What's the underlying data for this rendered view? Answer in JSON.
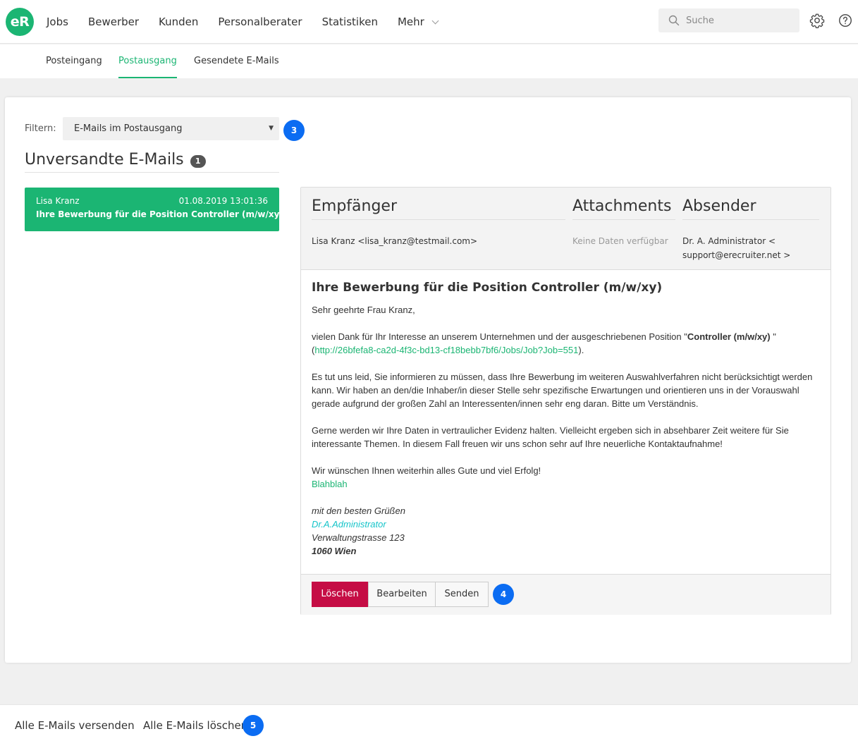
{
  "logo": {
    "text": "eR"
  },
  "nav": {
    "items": [
      "Jobs",
      "Bewerber",
      "Kunden",
      "Personalberater",
      "Statistiken"
    ],
    "more_label": "Mehr"
  },
  "search": {
    "placeholder": "Suche"
  },
  "icons": {
    "settings": "gear-icon",
    "help": "help-circle-icon",
    "search": "search-icon"
  },
  "subnav": {
    "tabs": [
      "Posteingang",
      "Postausgang",
      "Gesendete E-Mails"
    ],
    "active": "Postausgang"
  },
  "filter": {
    "label": "Filtern:",
    "selected": "E-Mails im Postausgang"
  },
  "callouts": {
    "filter": "3",
    "actions": "4",
    "bottom": "5"
  },
  "section": {
    "title": "Unversandte E-Mails",
    "count": "1"
  },
  "mail_list": [
    {
      "name": "Lisa Kranz",
      "date": "01.08.2019 13:01:36",
      "subject": "Ihre Bewerbung für die Position Controller (m/w/xy)"
    }
  ],
  "detail": {
    "recipient_title": "Empfänger",
    "attachments_title": "Attachments",
    "sender_title": "Absender",
    "recipient": "Lisa Kranz <lisa_kranz@testmail.com>",
    "attachments": "Keine Daten verfügbar",
    "sender_line1": "Dr. A. Administrator <",
    "sender_line2": "support@erecruiter.net >",
    "subject": "Ihre Bewerbung für die Position Controller (m/w/xy)",
    "greeting": "Sehr geehrte Frau Kranz,",
    "p1_before": "vielen Dank für Ihr Interesse an unserem Unternehmen und der ausgeschriebenen Position \"",
    "p1_bold": "Controller (m/w/xy)",
    "p1_after": " \"",
    "p1_link_open": "(",
    "p1_link": "http://26bfefa8-ca2d-4f3c-bd13-cf18bebb7bf6/Jobs/Job?Job=551",
    "p1_link_close": ").",
    "p2": "Es tut uns leid, Sie informieren zu müssen, dass Ihre Bewerbung im weiteren Auswahlverfahren nicht berücksichtigt werden kann. Wir haben an den/die Inhaber/in dieser Stelle sehr spezifische Erwartungen und orientieren uns in der Vorauswahl gerade aufgrund der großen Zahl an Interessenten/innen sehr eng daran. Bitte um Verständnis.",
    "p3": "Gerne werden wir Ihre Daten in vertraulicher Evidenz halten. Vielleicht ergeben sich in absehbarer Zeit weitere für Sie interessante Themen. In diesem Fall freuen wir uns schon sehr auf Ihre neuerliche Kontaktaufnahme!",
    "p4": "Wir wünschen Ihnen weiterhin alles Gute und viel Erfolg!",
    "p4_green": "Blahblah",
    "sig_regards": "mit den besten Grüßen",
    "sig_name": "Dr.A.Administrator",
    "sig_street": "Verwaltungstrasse 123",
    "sig_city": "1060 Wien"
  },
  "actions": {
    "delete": "Löschen",
    "edit": "Bearbeiten",
    "send": "Senden"
  },
  "bottom": {
    "send_all": "Alle E-Mails versenden",
    "delete_all": "Alle E-Mails löschen"
  },
  "colors": {
    "brand": "#1bb573",
    "danger": "#c50d45",
    "callout": "#0b6cf2"
  }
}
